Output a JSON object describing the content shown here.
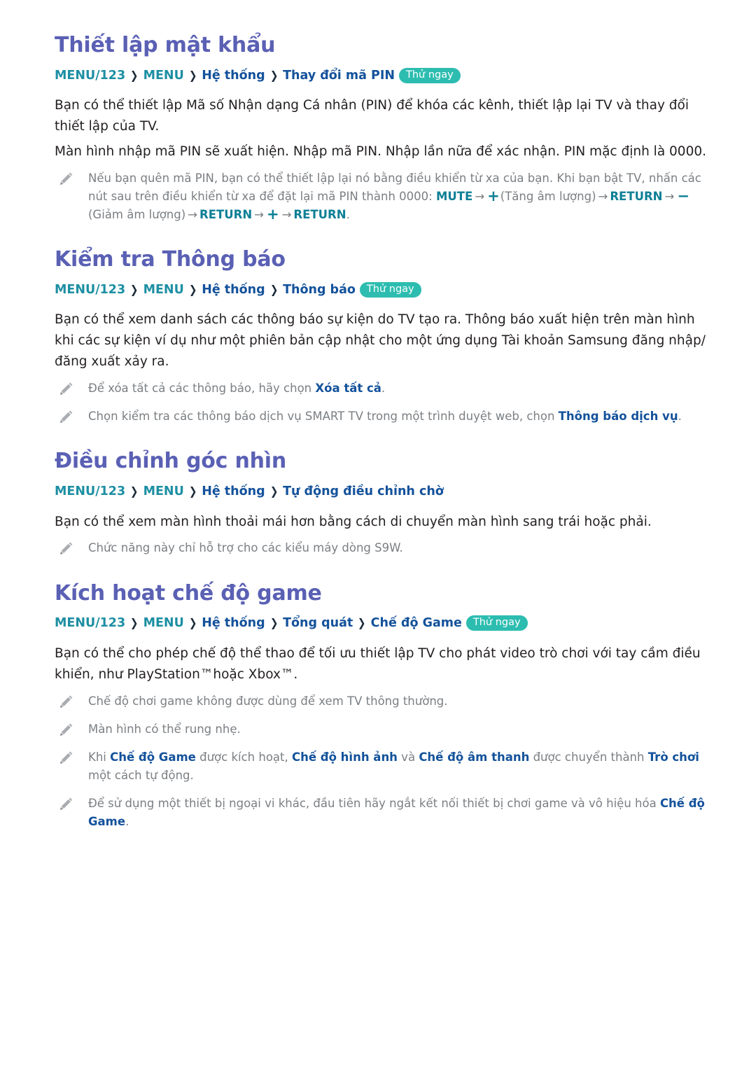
{
  "icons": {
    "note_icon": "pencil-icon"
  },
  "colors": {
    "heading": "#5a60b4",
    "crumb_teal": "#1d8fa3",
    "crumb_blue": "#14529b",
    "badge_bg": "#2dbdb0",
    "body_text": "#231f20",
    "note_text": "#7b7f83",
    "inline_blue": "#14529b",
    "inline_teal": "#0d7f96",
    "page_bg": "#ffffff"
  },
  "labels": {
    "try_now": "Thử ngay",
    "chevron": "❯"
  },
  "sections": [
    {
      "heading": "Thiết lập mật khẩu",
      "breadcrumb": {
        "crumbs": [
          {
            "text": "MENU/123",
            "style": "teal"
          },
          {
            "text": "MENU",
            "style": "teal"
          },
          {
            "text": "Hệ thống",
            "style": "blue"
          },
          {
            "text": "Thay đổi mã PIN",
            "style": "blue"
          }
        ],
        "badge": "Thử ngay"
      },
      "paragraphs": [
        "Bạn có thể thiết lập Mã số Nhận dạng Cá nhân (PIN) để khóa các kênh, thiết lập lại TV và thay đổi thiết lập của TV.",
        "Màn hình nhập mã PIN sẽ xuất hiện. Nhập mã PIN. Nhập lần nữa để xác nhận. PIN mặc định là 0000."
      ],
      "notes": [
        {
          "id": "note-pin-reset",
          "parts": [
            {
              "t": "text",
              "v": "Nếu bạn quên mã PIN, bạn có thể thiết lập lại nó bằng điều khiển từ xa của bạn. Khi bạn bật TV, nhấn các nút sau trên điều khiển từ xa để đặt lại mã PIN thành 0000: "
            },
            {
              "t": "teal",
              "v": "MUTE"
            },
            {
              "t": "arrow",
              "v": "→"
            },
            {
              "t": "sym",
              "v": "+"
            },
            {
              "t": "text",
              "v": "(Tăng âm lượng)"
            },
            {
              "t": "arrow",
              "v": "→"
            },
            {
              "t": "teal",
              "v": "RETURN"
            },
            {
              "t": "arrow",
              "v": "→"
            },
            {
              "t": "sym",
              "v": "−"
            },
            {
              "t": "text",
              "v": "(Giảm âm lượng)"
            },
            {
              "t": "arrow",
              "v": "→"
            },
            {
              "t": "teal",
              "v": "RETURN"
            },
            {
              "t": "arrow",
              "v": "→"
            },
            {
              "t": "sym",
              "v": "+"
            },
            {
              "t": "arrow",
              "v": "→"
            },
            {
              "t": "teal",
              "v": "RETURN"
            },
            {
              "t": "text",
              "v": "."
            }
          ]
        }
      ]
    },
    {
      "heading": "Kiểm tra Thông báo",
      "breadcrumb": {
        "crumbs": [
          {
            "text": "MENU/123",
            "style": "teal"
          },
          {
            "text": "MENU",
            "style": "teal"
          },
          {
            "text": "Hệ thống",
            "style": "blue"
          },
          {
            "text": "Thông báo",
            "style": "blue"
          }
        ],
        "badge": "Thử ngay"
      },
      "paragraph_parts": [
        {
          "t": "text",
          "v": "Bạn có thể xem danh sách các thông báo sự kiện do TV tạo ra. "
        },
        {
          "t": "blue",
          "v": "Thông báo"
        },
        {
          "t": "text",
          "v": " xuất hiện trên màn hình khi các sự kiện ví dụ như một phiên bản cập nhật cho một ứng dụng Tài khoản Samsung đăng nhập/đăng xuất xảy ra."
        }
      ],
      "notes": [
        {
          "id": "note-delete-all",
          "parts": [
            {
              "t": "text",
              "v": "Để xóa tất cả các thông báo, hãy chọn "
            },
            {
              "t": "blue",
              "v": "Xóa tất cả"
            },
            {
              "t": "text",
              "v": "."
            }
          ]
        },
        {
          "id": "note-service-notice",
          "parts": [
            {
              "t": "text",
              "v": "Chọn kiểm tra các thông báo dịch vụ SMART TV trong một trình duyệt web, chọn "
            },
            {
              "t": "blue",
              "v": "Thông báo dịch vụ"
            },
            {
              "t": "text",
              "v": "."
            }
          ]
        }
      ]
    },
    {
      "heading": "Điều chỉnh góc nhìn",
      "breadcrumb": {
        "crumbs": [
          {
            "text": "MENU/123",
            "style": "teal"
          },
          {
            "text": "MENU",
            "style": "teal"
          },
          {
            "text": "Hệ thống",
            "style": "blue"
          },
          {
            "text": "Tự động điều chỉnh chờ",
            "style": "blue"
          }
        ],
        "badge": null
      },
      "paragraphs": [
        "Bạn có thể xem màn hình thoải mái hơn bằng cách di chuyển màn hình sang trái hoặc phải."
      ],
      "notes": [
        {
          "id": "note-s9w-only",
          "parts": [
            {
              "t": "text",
              "v": "Chức năng này chỉ hỗ trợ cho các kiểu máy dòng S9W."
            }
          ]
        }
      ]
    },
    {
      "heading": "Kích hoạt chế độ game",
      "breadcrumb": {
        "crumbs": [
          {
            "text": "MENU/123",
            "style": "teal"
          },
          {
            "text": "MENU",
            "style": "teal"
          },
          {
            "text": "Hệ thống",
            "style": "blue"
          },
          {
            "text": "Tổng quát",
            "style": "blue"
          },
          {
            "text": "Chế độ Game",
            "style": "blue"
          }
        ],
        "badge": "Thử ngay"
      },
      "paragraphs": [
        "Bạn có thể cho phép chế độ thể thao để tối ưu thiết lập TV cho phát video trò chơi với tay cầm điều khiển, như PlayStation™hoặc Xbox™."
      ],
      "notes": [
        {
          "id": "note-game-not-tv",
          "parts": [
            {
              "t": "text",
              "v": "Chế độ chơi game không được dùng để xem TV thông thường."
            }
          ]
        },
        {
          "id": "note-screen-shake",
          "parts": [
            {
              "t": "text",
              "v": "Màn hình có thể rung nhẹ."
            }
          ]
        },
        {
          "id": "note-auto-switch",
          "parts": [
            {
              "t": "text",
              "v": "Khi "
            },
            {
              "t": "blue",
              "v": "Chế độ Game"
            },
            {
              "t": "text",
              "v": " được kích hoạt, "
            },
            {
              "t": "blue",
              "v": "Chế độ hình ảnh"
            },
            {
              "t": "text",
              "v": " và "
            },
            {
              "t": "blue",
              "v": "Chế độ âm thanh"
            },
            {
              "t": "text",
              "v": " được chuyển thành "
            },
            {
              "t": "blue",
              "v": "Trò chơi"
            },
            {
              "t": "text",
              "v": " một cách tự động."
            }
          ]
        },
        {
          "id": "note-disconnect-device",
          "parts": [
            {
              "t": "text",
              "v": "Để sử dụng một thiết bị ngoại vi khác, đầu tiên hãy ngắt kết nối thiết bị chơi game và vô hiệu hóa "
            },
            {
              "t": "blue",
              "v": "Chế độ Game"
            },
            {
              "t": "text",
              "v": "."
            }
          ]
        }
      ]
    }
  ]
}
